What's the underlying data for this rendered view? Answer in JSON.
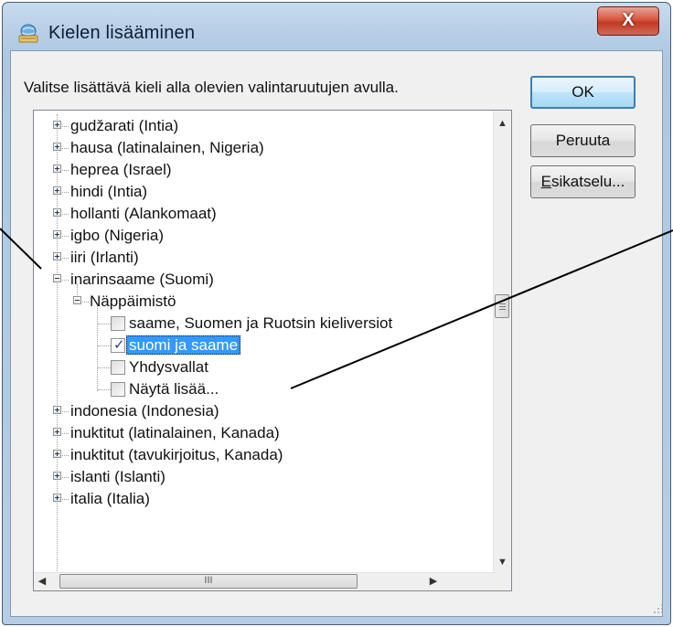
{
  "window": {
    "title": "Kielen lisääminen",
    "close_glyph": "X",
    "icon": "globe-keyboard-icon"
  },
  "instruction": "Valitse lisättävä kieli alla olevien valintaruutujen avulla.",
  "buttons": {
    "ok": "OK",
    "cancel": "Peruuta",
    "preview_mnemonic": "E",
    "preview_rest": "sikatselu..."
  },
  "tree": {
    "languages_before": [
      "gudžarati (Intia)",
      "hausa (latinalainen, Nigeria)",
      "heprea (Israel)",
      "hindi (Intia)",
      "hollanti (Alankomaat)",
      "igbo (Nigeria)",
      "iiri (Irlanti)"
    ],
    "expanded_language": "inarinsaame (Suomi)",
    "group_label": "Näppäimistö",
    "keyboards": [
      {
        "label": "saame, Suomen ja Ruotsin kieliversiot",
        "checked": false
      },
      {
        "label": "suomi ja saame",
        "checked": true,
        "selected": true
      },
      {
        "label": "Yhdysvallat",
        "checked": false
      },
      {
        "label": "Näytä lisää...",
        "checked": false
      }
    ],
    "languages_after": [
      "indonesia (Indonesia)",
      "inuktitut (latinalainen, Kanada)",
      "inuktitut (tavukirjoitus, Kanada)",
      "islanti (Islanti)",
      "italia (Italia)"
    ],
    "hscroll_thumb_glyph": "III"
  },
  "colors": {
    "selection": "#3399ff",
    "close_button": "#c23a22",
    "default_button_border": "#3c7fb1"
  }
}
